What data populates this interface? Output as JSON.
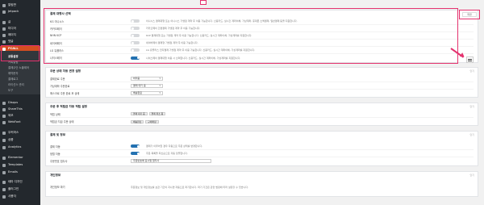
{
  "sidebar": {
    "items": [
      {
        "label": "알림판"
      },
      {
        "label": "Jetpack"
      },
      {
        "label": "글"
      },
      {
        "label": "미디어"
      },
      {
        "label": "페이지"
      },
      {
        "label": "댓글"
      },
      {
        "label": "PCALL"
      }
    ],
    "sub_items": [
      {
        "label": "공통설정"
      },
      {
        "label": "카톡알림"
      },
      {
        "label": "결제수단 노출제어"
      },
      {
        "label": "예약문자"
      },
      {
        "label": "결제로그"
      },
      {
        "label": "라이선스 관리"
      },
      {
        "label": "도구"
      }
    ],
    "lower_items": [
      {
        "label": "Disqus"
      },
      {
        "label": "ShareThis"
      },
      {
        "label": "외모"
      },
      {
        "label": "WebFont"
      },
      {
        "label": "우커머스"
      },
      {
        "label": "상품"
      },
      {
        "label": "Analytics"
      },
      {
        "label": "Elementor"
      },
      {
        "label": "Templates"
      },
      {
        "label": "Emails"
      },
      {
        "label": "테마 디자인"
      },
      {
        "label": "플러그인"
      },
      {
        "label": "사용자"
      }
    ]
  },
  "toolbar": {
    "screen_options": "화면"
  },
  "panels": [
    {
      "title": "결제 대행사 선택",
      "collapse": "닫기",
      "rows": [
        {
          "label": "KG 이니시스",
          "on": false,
          "desc": "이니시스 결제대행 또는 이니시스 가맹점 계약 후 이용 가능합니다. 신용카드, 실시간 계좌이체, 가상계좌, 휴대폰 소액결제, 일반결제 등을 지원합니다."
        },
        {
          "label": "카카오페이",
          "on": false,
          "desc": "카카오페이 간편결제 가맹점 계약 후 이용 가능합니다."
        },
        {
          "label": "NHN KCP",
          "on": false,
          "desc": "KCP 결제대행 또는 가맹점 계약 후 이용 가능합니다. 신용카드, 실시간 계좌이체, 가상계좌를 지원합니다."
        },
        {
          "label": "네이버페이",
          "on": false,
          "desc": "네이버페이 결제형 가맹점 계약 후 이용 가능합니다."
        },
        {
          "label": "LG 유플러스",
          "on": false,
          "desc": "LG 유플러스 전자결제 가맹점 계약 후 이용 가능합니다. 신용카드, 실시간 계좌이체, 가상계좌를 지원합니다."
        },
        {
          "label": "나이스페이",
          "on": true,
          "desc": "나이스페이 결제대행 이용 시 선택합니다. 신용카드, 실시간 계좌이체, 가상계좌를 지원합니다."
        }
      ]
    },
    {
      "title": "주문 상태 자동 변경 설정",
      "collapse": "닫기",
      "rows": [
        {
          "label": "결제완료 주문",
          "select": "처리중"
        },
        {
          "label": "가상계좌 주문완료",
          "select": "결제 대기 중"
        },
        {
          "label": "에스크로 주문 완료 후 상태",
          "select": "배송완료"
        }
      ]
    },
    {
      "title": "주문 후 적립금 자동 적립 설정",
      "collapse": "닫기",
      "rows": [
        {
          "label": "적립 상태",
          "tags": [
            "결제 대기 중",
            "결제 취소 됨"
          ]
        },
        {
          "label": "적립금 지급 주문 상태",
          "tags": [
            "배송완료",
            "구매확정"
          ]
        }
      ]
    },
    {
      "title": "결제 및 정보",
      "collapse": "닫기",
      "rows": [
        {
          "label": "결제 자동",
          "on": true,
          "desc": "결제가 이루어질 경우 자동으로 주문 상태를 변경합니다."
        },
        {
          "label": "정렬 자동",
          "on": true,
          "desc": "주문 목록을 최신순으로 자동 정렬합니다."
        },
        {
          "label": "주문번호 접두사",
          "text": "주문번호에 표시될 접두사"
        }
      ]
    },
    {
      "title": "개인정보",
      "collapse": "닫기",
      "rows": [
        {
          "label": "개인정보 파기",
          "desc": "주문정보 및 개인정보를 보관 기간이 지나면 자동으로 파기합니다. 파기 기간은 관련 법령에 따라 설정할 수 있습니다."
        }
      ]
    }
  ]
}
